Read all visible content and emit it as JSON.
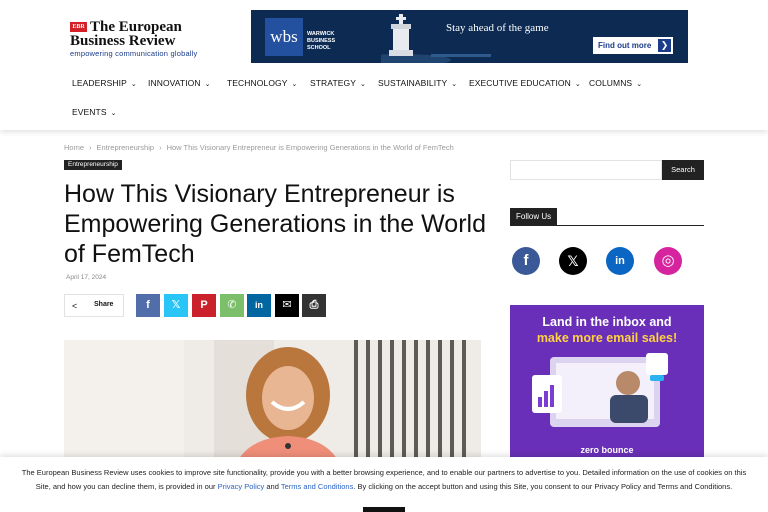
{
  "header": {
    "logo_mark": "EBR",
    "logo_line1": "The European",
    "logo_line2": "Business Review",
    "logo_tagline": "empowering communication globally",
    "ad": {
      "wbs": "wbs",
      "school": "WARWICK BUSINESS SCHOOL",
      "slogan": "Stay ahead of the game",
      "cta": "Find out more",
      "cta_arrow": "❯"
    }
  },
  "nav": {
    "items": [
      "LEADERSHIP",
      "INNOVATION",
      "TECHNOLOGY",
      "STRATEGY",
      "SUSTAINABILITY",
      "EXECUTIVE EDUCATION",
      "COLUMNS",
      "EVENTS"
    ],
    "chevron": "⌄"
  },
  "article": {
    "breadcrumb": [
      "Home",
      "Entrepreneurship",
      "How This Visionary Entrepreneur is Empowering Generations in the World of FemTech"
    ],
    "breadcrumb_sep": "›",
    "category": "Entrepreneurship",
    "title": "How This Visionary Entrepreneur is Empowering Generations in the World of FemTech",
    "date": "April 17, 2024",
    "share_label": "Share",
    "share_icon": "share-icon",
    "social": [
      {
        "name": "facebook",
        "glyph": "f",
        "color": "#516eab"
      },
      {
        "name": "x",
        "glyph": "𝕏",
        "color": "#29c5f6"
      },
      {
        "name": "pinterest",
        "glyph": "P",
        "color": "#ca212a"
      },
      {
        "name": "whatsapp",
        "glyph": "✆",
        "color": "#7bbf6a"
      },
      {
        "name": "linkedin",
        "glyph": "in",
        "color": "#0266a0"
      },
      {
        "name": "email",
        "glyph": "✉",
        "color": "#000000"
      },
      {
        "name": "print",
        "glyph": "⎙",
        "color": "#333333"
      }
    ]
  },
  "sidebar": {
    "search_placeholder": "",
    "search_button": "Search",
    "follow_label": "Follow Us",
    "follow_icons": [
      {
        "name": "facebook",
        "glyph": "f",
        "color": "#3b5998"
      },
      {
        "name": "x",
        "glyph": "𝕏",
        "color": "#000000"
      },
      {
        "name": "linkedin",
        "glyph": "in",
        "color": "#0a66c2"
      },
      {
        "name": "instagram",
        "glyph": "◎",
        "color": "#d6249f"
      }
    ],
    "ad": {
      "line1": "Land in the inbox and",
      "line2": "make more email sales!",
      "brand": "zero bounce"
    }
  },
  "cookie": {
    "text_before": "The European Business Review uses cookies to improve site functionality, provide you with a better browsing experience, and to enable our partners to advertise to you. Detailed information on the use of cookies on this Site, and how you can decline them, is provided in our ",
    "privacy_link": "Privacy Policy",
    "and": " and ",
    "terms_link": "Terms and Conditions",
    "text_after": ". By clicking on the accept button and using this Site, you consent to our Privacy Policy and Terms and Conditions."
  }
}
